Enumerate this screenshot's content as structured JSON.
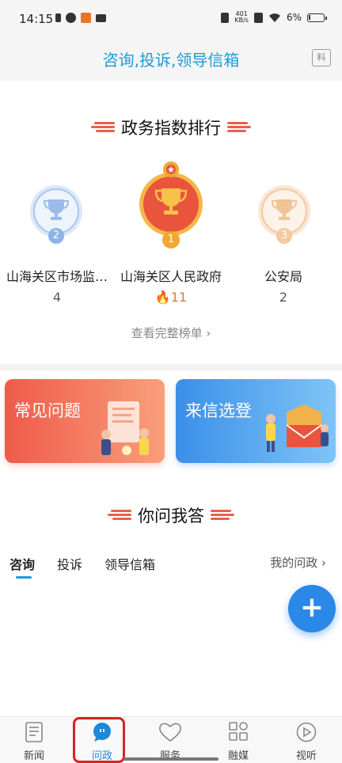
{
  "status_bar": {
    "time": "14:15",
    "net_speed_value": "401",
    "net_speed_unit": "KB/s",
    "battery": "6%"
  },
  "header": {
    "title": "咨询,投诉,领导信箱",
    "right_icon": "message-icon"
  },
  "ranking": {
    "title": "政务指数排行",
    "items": [
      {
        "rank": "2",
        "name": "山海关区市场监…",
        "count": "4"
      },
      {
        "rank": "1",
        "name": "山海关区人民政府",
        "count": "11"
      },
      {
        "rank": "3",
        "name": "公安局",
        "count": "2"
      }
    ],
    "view_all": "查看完整榜单"
  },
  "cards": {
    "faq": "常见问题",
    "letters": "来信选登"
  },
  "qa": {
    "title": "你问我答",
    "tabs": [
      "咨询",
      "投诉",
      "领导信箱"
    ],
    "my_link": "我的问政"
  },
  "fab": {
    "icon": "plus-icon"
  },
  "bottom_nav": {
    "items": [
      {
        "label": "新闻",
        "icon": "news-icon"
      },
      {
        "label": "问政",
        "icon": "chat-bubble-icon"
      },
      {
        "label": "服务",
        "icon": "heart-icon"
      },
      {
        "label": "融媒",
        "icon": "grid-icon"
      },
      {
        "label": "视听",
        "icon": "play-icon"
      }
    ],
    "active_index": 1
  },
  "colors": {
    "accent": "#1e9bd7",
    "gold": "#f0a830",
    "silver": "#8eb4e6",
    "bronze": "#f2c9a0",
    "faq_card": "#f05a4a",
    "letters_card": "#3a8fe8",
    "highlight": "#d92222"
  }
}
